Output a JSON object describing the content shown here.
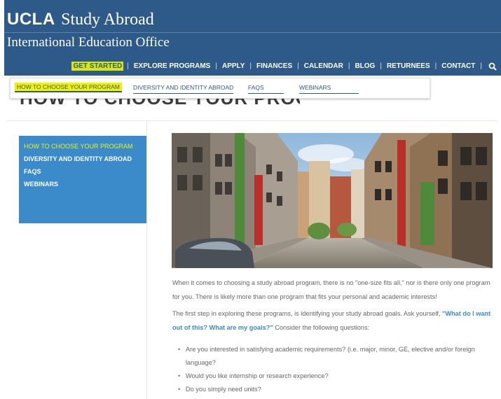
{
  "header": {
    "logo_ucla": "UCLA",
    "logo_study_abroad": "Study Abroad",
    "subtitle": "International Education Office",
    "bg_color": "#2d5a88"
  },
  "topnav": {
    "items": [
      "GET STARTED",
      "EXPLORE PROGRAMS",
      "APPLY",
      "FINANCES",
      "CALENDAR",
      "BLOG",
      "RETURNEES",
      "CONTACT"
    ],
    "active_index": 0,
    "search_icon": "search-icon"
  },
  "subnav": {
    "items": [
      "HOW TO CHOOSE YOUR PROGRAM",
      "DIVERSITY AND IDENTITY ABROAD",
      "FAQS",
      "WEBINARS"
    ],
    "active_index": 0,
    "highlight_color": "#f2f200"
  },
  "page": {
    "title": "HOW TO CHOOSE YOUR PROGRAM"
  },
  "sidebar": {
    "items": [
      "HOW TO CHOOSE YOUR PROGRAM",
      "DIVERSITY AND IDENTITY ABROAD",
      "FAQS",
      "WEBINARS"
    ],
    "active_index": 0,
    "bg_color": "#3b8bcb"
  },
  "content": {
    "p1": "When it comes to choosing a study abroad program, there is no \"one-size fits all,\" nor is there only one program for you. There is likely more than one program that fits your personal and academic interests!",
    "p2_start": "The first step in exploring these programs, is identifying your study abroad goals. Ask yourself, ",
    "p2_highlight": "\"What do I want out of this? What are my goals?\"",
    "p2_end": " Consider the following questions:",
    "questions": [
      "Are you interested in satisfying academic requirements? (i.e. major, minor, GE, elective and/or foreign language?",
      "Would you like internship or research experience?",
      "Do you simply need units?"
    ]
  }
}
